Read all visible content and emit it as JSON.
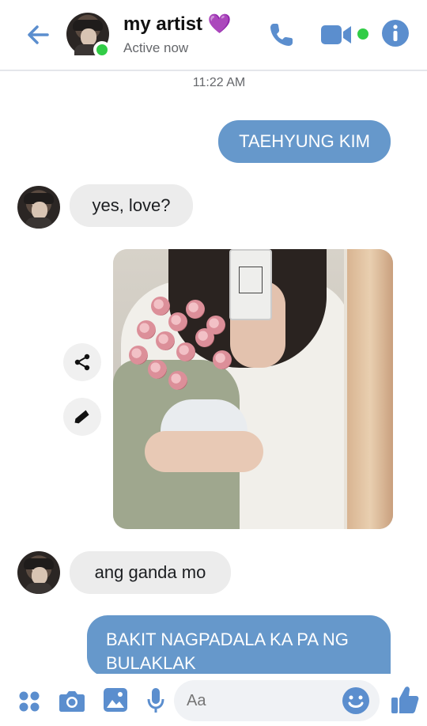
{
  "header": {
    "contact_name": "my artist",
    "name_emoji": "💜",
    "status": "Active now"
  },
  "chat": {
    "timestamp": "11:22 AM",
    "messages": [
      {
        "from": "me",
        "text": "TAEHYUNG KIM"
      },
      {
        "from": "them",
        "text": "yes, love?"
      },
      {
        "from": "them",
        "type": "photo"
      },
      {
        "from": "them",
        "text": "ang ganda mo"
      },
      {
        "from": "me",
        "text": "BAKIT NAGPADALA KA PA NG BULAKLAK"
      }
    ]
  },
  "composer": {
    "placeholder": "Aa"
  },
  "colors": {
    "accent": "#5b8ece",
    "outgoing_bubble": "#6698cb",
    "incoming_bubble": "#ececec",
    "online": "#31cc46"
  },
  "icons": {
    "back": "arrow-left-icon",
    "call": "phone-icon",
    "video": "video-camera-icon",
    "info": "info-icon",
    "share": "share-icon",
    "edit": "pencil-icon",
    "apps": "four-dots-icon",
    "camera": "camera-icon",
    "gallery": "image-icon",
    "mic": "microphone-icon",
    "emoji": "smiley-icon",
    "like": "thumbs-up-icon"
  }
}
